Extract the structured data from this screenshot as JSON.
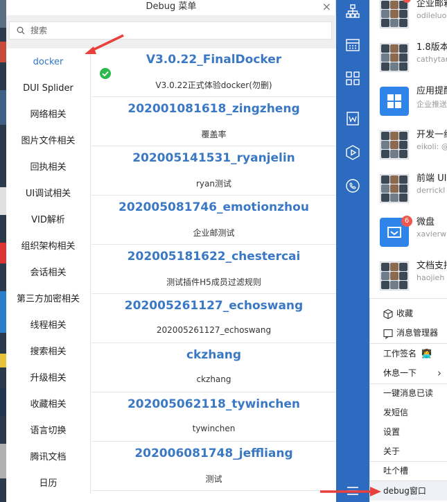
{
  "dialog": {
    "title": "Debug 菜单",
    "close": "×",
    "search_placeholder": "搜索"
  },
  "sidebar": {
    "active_index": 0,
    "items": [
      "docker",
      "DUI Splider",
      "网络相关",
      "图片文件相关",
      "回执相关",
      "UI调试相关",
      "VID解析",
      "组织架构相关",
      "会话相关",
      "第三方加密相关",
      "线程相关",
      "搜索相关",
      "升级相关",
      "收藏相关",
      "语言切换",
      "腾讯文档",
      "日历"
    ]
  },
  "entries": [
    {
      "title": "V3.0.22_FinalDocker",
      "subtitle": "V3.0.22正式体验docker(勿删)"
    },
    {
      "title": "202001081618_zingzheng",
      "subtitle": "覆盖率"
    },
    {
      "title": "202005141531_ryanjelin",
      "subtitle": "ryan测试"
    },
    {
      "title": "202005081746_emotionzhou",
      "subtitle": "企业邮测试"
    },
    {
      "title": "202005181622_chestercai",
      "subtitle": "测试插件H5成员过滤规则"
    },
    {
      "title": "202005261127_echoswang",
      "subtitle": "202005261127_echoswang"
    },
    {
      "title": "ckzhang",
      "subtitle": "ckzhang"
    },
    {
      "title": "202005062118_tywinchen",
      "subtitle": "tywinchen"
    },
    {
      "title": "202006081748_jeffliang",
      "subtitle": "测试"
    }
  ],
  "rail_icons": [
    "org-chart-icon",
    "calendar-icon",
    "apps-grid-icon",
    "document-w-icon",
    "hexagon-play-icon",
    "cloud-phone-icon",
    "menu-icon"
  ],
  "chats": [
    {
      "name": "企业邮箱",
      "preview": "odileluo",
      "type": "group"
    },
    {
      "name": "1.8版本",
      "preview": "cathytan",
      "type": "group"
    },
    {
      "name": "应用提醒",
      "preview": "企业推送",
      "type": "app"
    },
    {
      "name": "开发一组",
      "preview": "eikoli: @",
      "type": "group"
    },
    {
      "name": "前端 UI",
      "preview": "derrickl",
      "type": "group"
    },
    {
      "name": "微盘",
      "preview": "xavierw",
      "type": "drive",
      "badge": "6"
    },
    {
      "name": "文档支持",
      "preview": "haojieh",
      "type": "group"
    }
  ],
  "menu": {
    "items": [
      "收藏",
      "消息管理器",
      "工作签名",
      "休息一下",
      "一键消息已读",
      "发短信",
      "设置",
      "关于",
      "吐个槽",
      "debug窗口"
    ],
    "more_arrow": "›",
    "signature_emoji": "👩‍💻"
  },
  "colors": {
    "accent": "#3a78c4",
    "rail": "#2c6bc0",
    "badge": "#f0564c",
    "check": "#2db84d",
    "arrow": "#e8413c"
  }
}
